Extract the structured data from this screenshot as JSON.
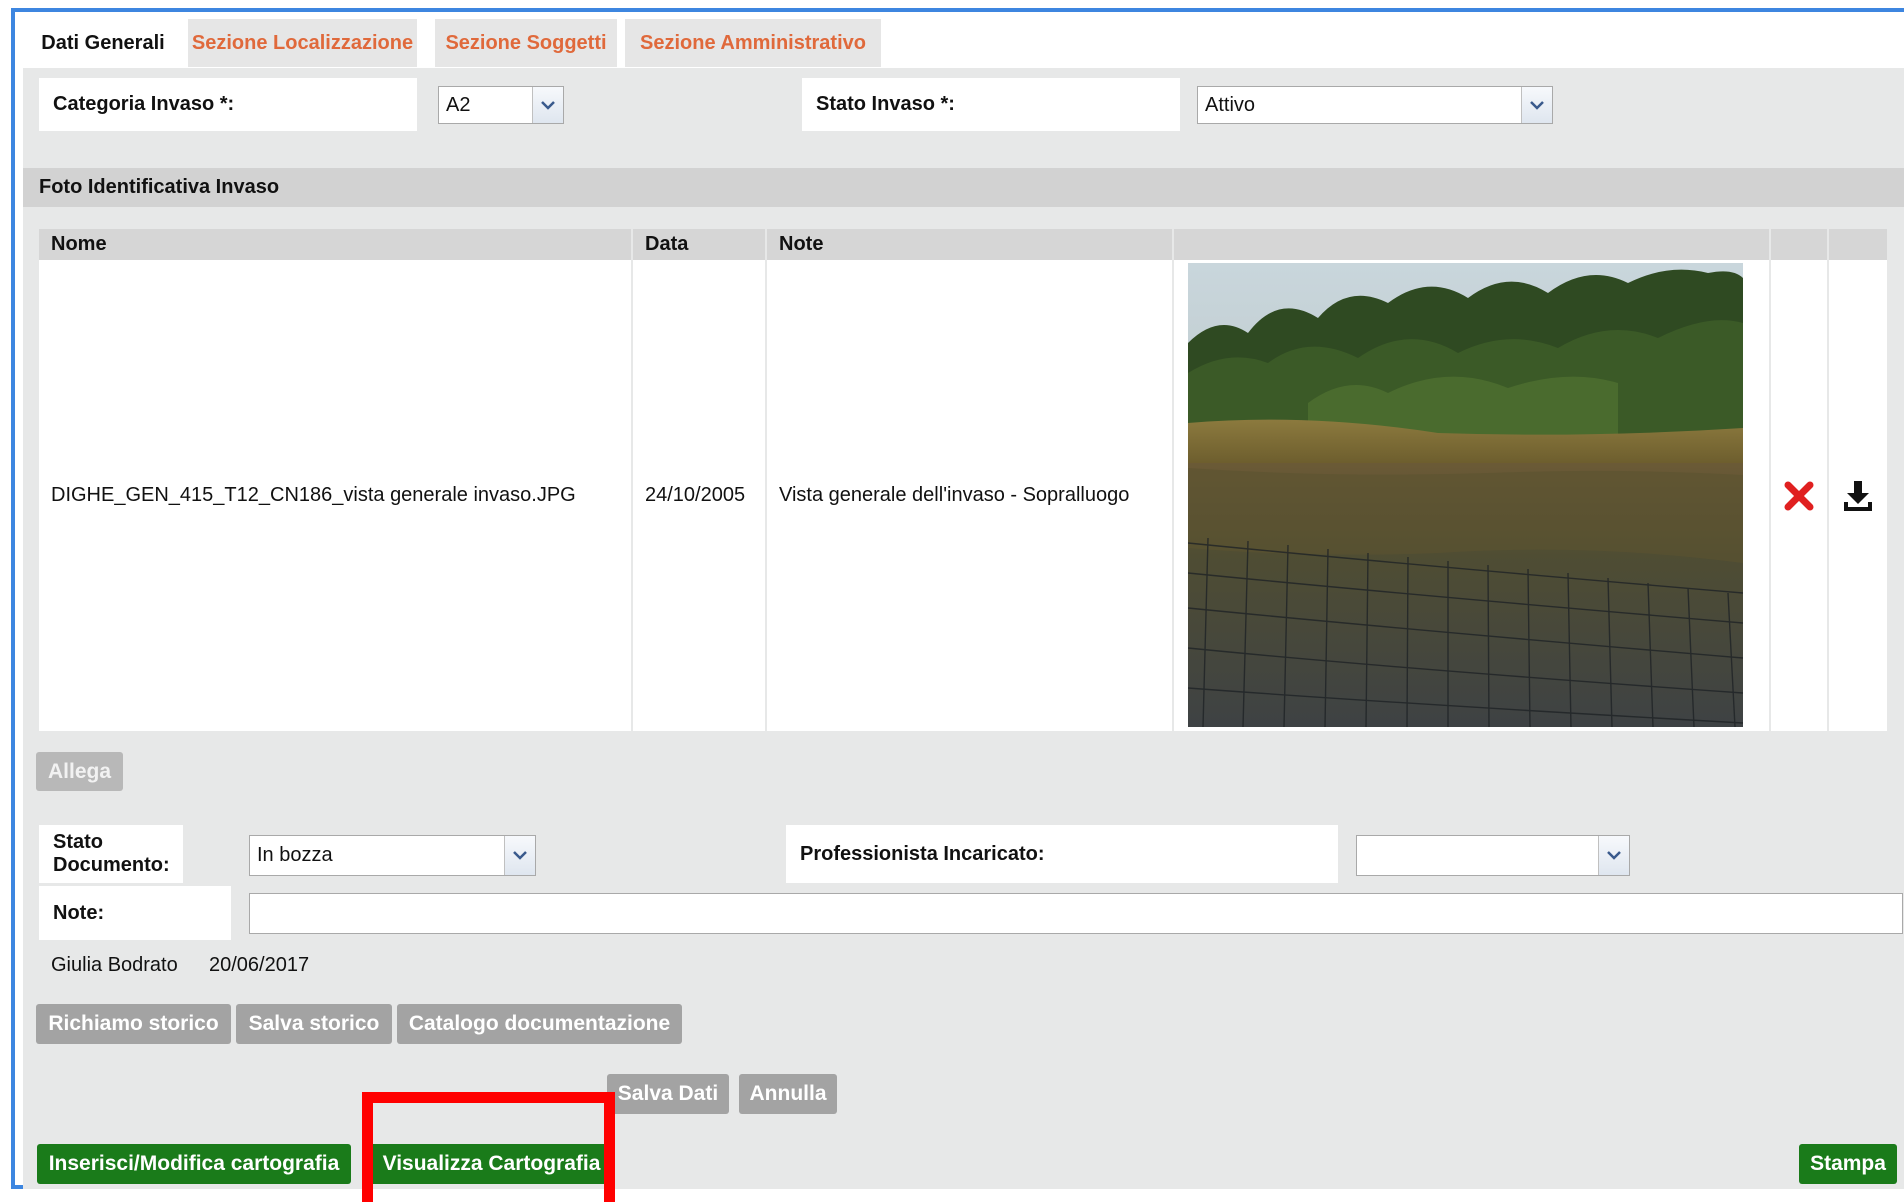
{
  "tabs": [
    {
      "label": "Dati Generali",
      "active": true
    },
    {
      "label": "Sezione Localizzazione",
      "active": false
    },
    {
      "label": "Sezione Soggetti",
      "active": false
    },
    {
      "label": "Sezione Amministrativo",
      "active": false
    }
  ],
  "top_form": {
    "categoria_label": "Categoria Invaso *:",
    "categoria_value": "A2",
    "stato_label": "Stato Invaso *:",
    "stato_value": "Attivo"
  },
  "photo_section": {
    "title": "Foto Identificativa Invaso",
    "columns": [
      "Nome",
      "Data",
      "Note"
    ],
    "row": {
      "nome": "DIGHE_GEN_415_T12_CN186_vista generale invaso.JPG",
      "data": "24/10/2005",
      "note": "Vista generale dell'invaso - Sopralluogo"
    },
    "allega_label": "Allega"
  },
  "document": {
    "stato_label": "Stato Documento:",
    "stato_value": "In bozza",
    "professionista_label": "Professionista Incaricato:",
    "professionista_value": "",
    "note_label": "Note:",
    "note_value": ""
  },
  "meta": {
    "author": "Giulia Bodrato",
    "date": "20/06/2017"
  },
  "buttons": {
    "richiamo_storico": "Richiamo storico",
    "salva_storico": "Salva storico",
    "catalogo_documentazione": "Catalogo documentazione",
    "salva_dati": "Salva Dati",
    "annulla": "Annulla",
    "inserisci_cartografia": "Inserisci/Modifica cartografia",
    "visualizza_cartografia": "Visualizza Cartografia",
    "stampa": "Stampa"
  },
  "colors": {
    "frame_border": "#3d86e0",
    "tab_inactive_text": "#e0693b",
    "green_button": "#1a7b1a",
    "highlight_box": "#ff0000",
    "delete_icon": "#e02020"
  },
  "icons": {
    "delete": "close-x-icon",
    "download": "download-icon",
    "dropdown": "chevron-down-icon"
  }
}
